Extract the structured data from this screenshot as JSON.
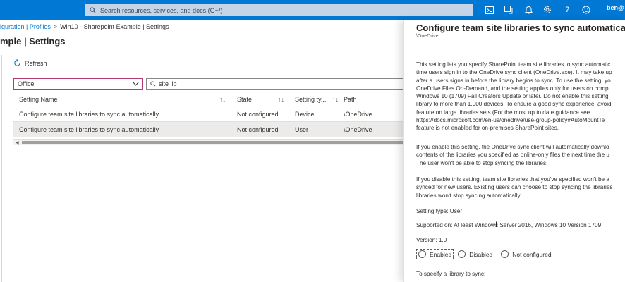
{
  "topbar": {
    "search_placeholder": "Search resources, services, and docs (G+/)",
    "user": "ben@",
    "icons": [
      "cloud-shell-icon",
      "directory-filter-icon",
      "notifications-icon",
      "settings-icon",
      "help-icon",
      "feedback-icon"
    ]
  },
  "breadcrumb": {
    "link": "iguration | Profiles",
    "sep": ">",
    "current": "Win10 - Sharepoint Example | Settings"
  },
  "page_title": "mple | Settings",
  "toolbar": {
    "refresh_label": "Refresh"
  },
  "filters": {
    "dropdown_value": "Office",
    "search_value": "site lib"
  },
  "grid": {
    "columns": [
      "Setting Name",
      "State",
      "Setting ty...",
      "Path"
    ],
    "rows": [
      {
        "name": "Configure team site libraries to sync automatically",
        "state": "Not configured",
        "type": "Device",
        "path": "\\OneDrive"
      },
      {
        "name": "Configure team site libraries to sync automatically",
        "state": "Not configured",
        "type": "User",
        "path": "\\OneDrive"
      }
    ]
  },
  "panel": {
    "title": "Configure team site libraries to sync automatically",
    "subtitle": "\\OneDrive",
    "para1": [
      "This setting lets you specify SharePoint team site libraries to sync automatic",
      "time users sign in to the OneDrive sync client (OneDrive.exe). It may take up",
      "after a users signs in before the library begins to sync. To use the setting, yo",
      "OneDrive Files On-Demand, and the setting applies only for users on comp",
      "Windows 10 (1709) Fall Creators Update or later. Do not enable this setting",
      "library to more than 1,000 devices. To ensure a good sync experience, avoid",
      "feature on large libraries sets (For the most up to date guidance see",
      "https://docs.microsoft.com/en-us/onedrive/use-group-policy#AutoMountTe",
      "feature is not enabled for on-premises SharePoint sites."
    ],
    "para2": [
      "If you enable this setting, the OneDrive sync client will automatically downlo",
      "contents of the libraries you specified as online-only files the next time the u",
      "The user won't be able to stop syncing the libraries."
    ],
    "para3": [
      "If you disable this setting, team site libraries that you've specified won't be a",
      "synced for new users. Existing users can choose to stop syncing the libraries",
      "libraries won't stop syncing automatically."
    ],
    "setting_type": "Setting type: User",
    "supported_on": "Supported on: At least Windows Server 2016, Windows 10 Version 1709",
    "version": "Version: 1.0",
    "options": [
      "Enabled",
      "Disabled",
      "Not configured"
    ],
    "specify_label": "To specify a library to sync:"
  }
}
